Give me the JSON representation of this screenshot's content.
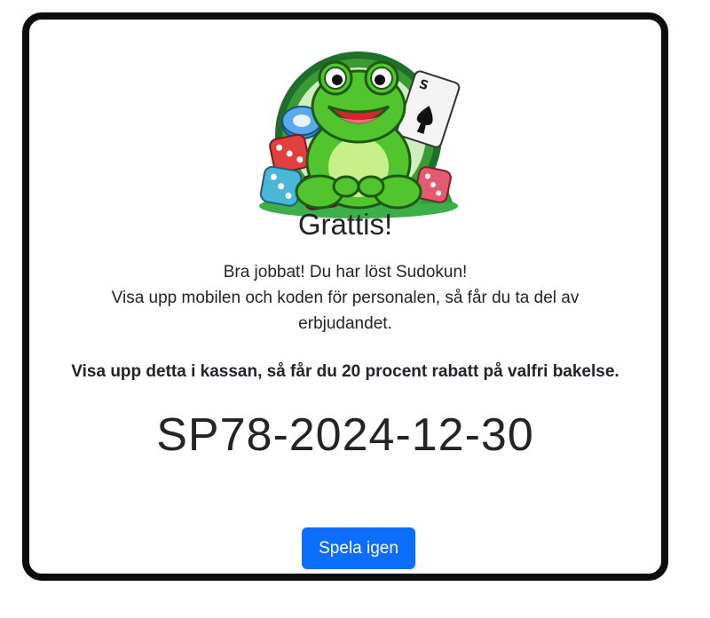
{
  "dialog": {
    "title": "Grattis!",
    "message_lines": [
      "Bra jobbat! Du har löst Sudokun!",
      "Visa upp mobilen och koden för personalen, så får du ta del av erbjudandet."
    ],
    "offer_text": "Visa upp detta i kassan, så får du 20 procent rabatt på valfri bakelse.",
    "code": "SP78-2024-12-30",
    "play_again_label": "Spela igen"
  },
  "mascot": {
    "icon": "frog-mascot-icon",
    "card_corner": "S"
  },
  "colors": {
    "primary_button": "#0d6efd",
    "frame_border": "#0d0d0d",
    "frog_green": "#52c42d"
  }
}
